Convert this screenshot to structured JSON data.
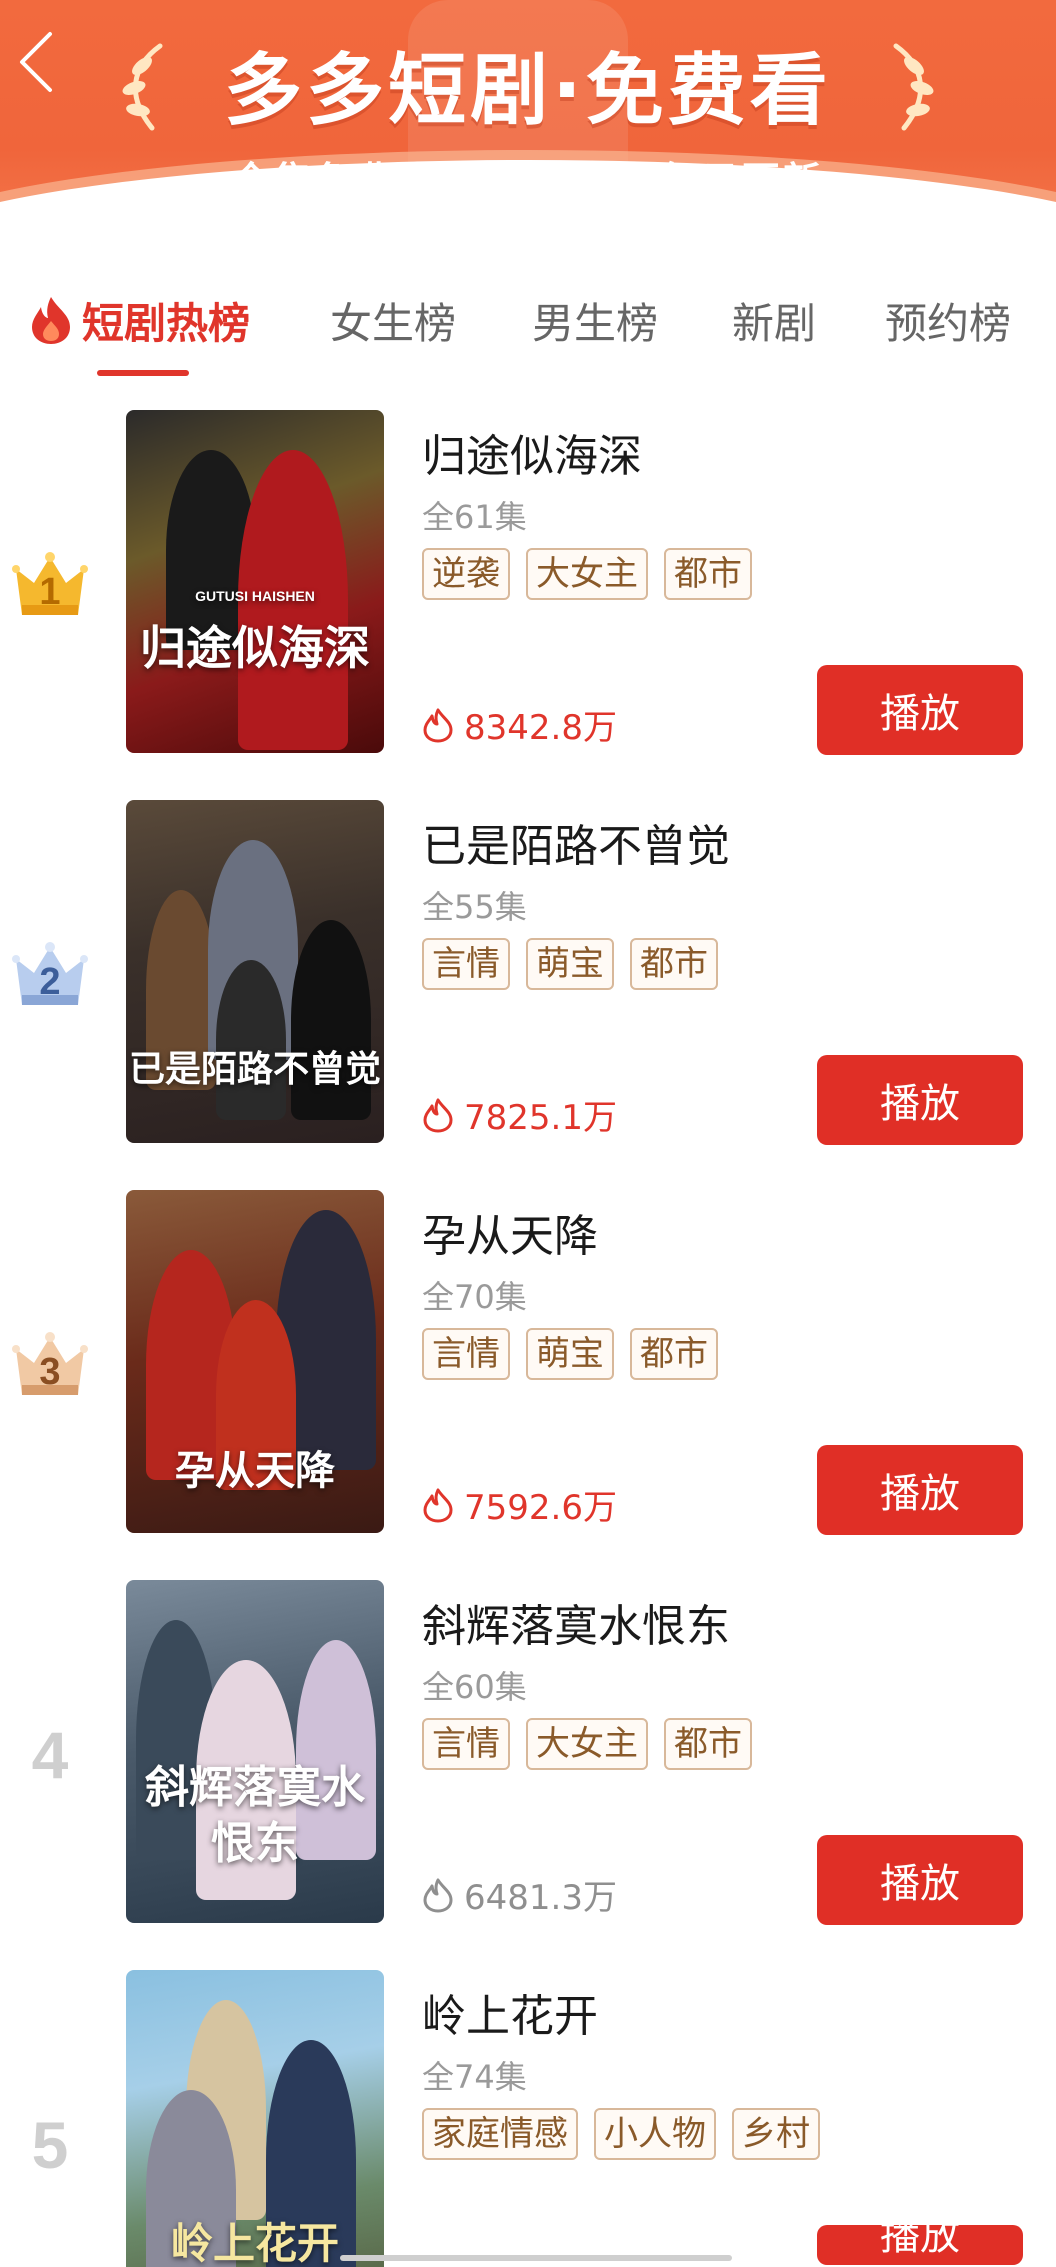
{
  "banner": {
    "title": "多多短剧·免费看",
    "subtitle": "全集免费 · 正版授权 · 每日更新",
    "accent": "#f26a3e"
  },
  "tabs": [
    {
      "label": "短剧热榜",
      "active": true,
      "icon": "flame-icon"
    },
    {
      "label": "女生榜",
      "active": false
    },
    {
      "label": "男生榜",
      "active": false
    },
    {
      "label": "新剧",
      "active": false
    },
    {
      "label": "预约榜",
      "active": false
    }
  ],
  "list": {
    "play_label": "播放",
    "items": [
      {
        "rank": "1",
        "title": "归途似海深",
        "episodes": "全61集",
        "tags": [
          "逆袭",
          "大女主",
          "都市"
        ],
        "heat": "8342.8万",
        "poster_text": "归途似海深",
        "poster_subtext": "GUTUSI HAISHEN"
      },
      {
        "rank": "2",
        "title": "已是陌路不曾觉",
        "episodes": "全55集",
        "tags": [
          "言情",
          "萌宝",
          "都市"
        ],
        "heat": "7825.1万",
        "poster_text": "已是陌路不曾觉"
      },
      {
        "rank": "3",
        "title": "孕从天降",
        "episodes": "全70集",
        "tags": [
          "言情",
          "萌宝",
          "都市"
        ],
        "heat": "7592.6万",
        "poster_text": "孕从天降"
      },
      {
        "rank": "4",
        "title": "斜辉落寞水恨东",
        "episodes": "全60集",
        "tags": [
          "言情",
          "大女主",
          "都市"
        ],
        "heat": "6481.3万",
        "poster_text": "斜辉落寞水恨东"
      },
      {
        "rank": "5",
        "title": "岭上花开",
        "episodes": "全74集",
        "tags": [
          "家庭情感",
          "小人物",
          "乡村"
        ],
        "heat": "",
        "poster_text": "岭上花开"
      }
    ]
  },
  "colors": {
    "primary_red": "#e02f26",
    "tag_border": "#d8b89a",
    "tag_text": "#8a5a2a",
    "gold_crown": "#f5b82e",
    "silver_crown": "#9bb5de",
    "bronze_crown": "#e9b893"
  }
}
